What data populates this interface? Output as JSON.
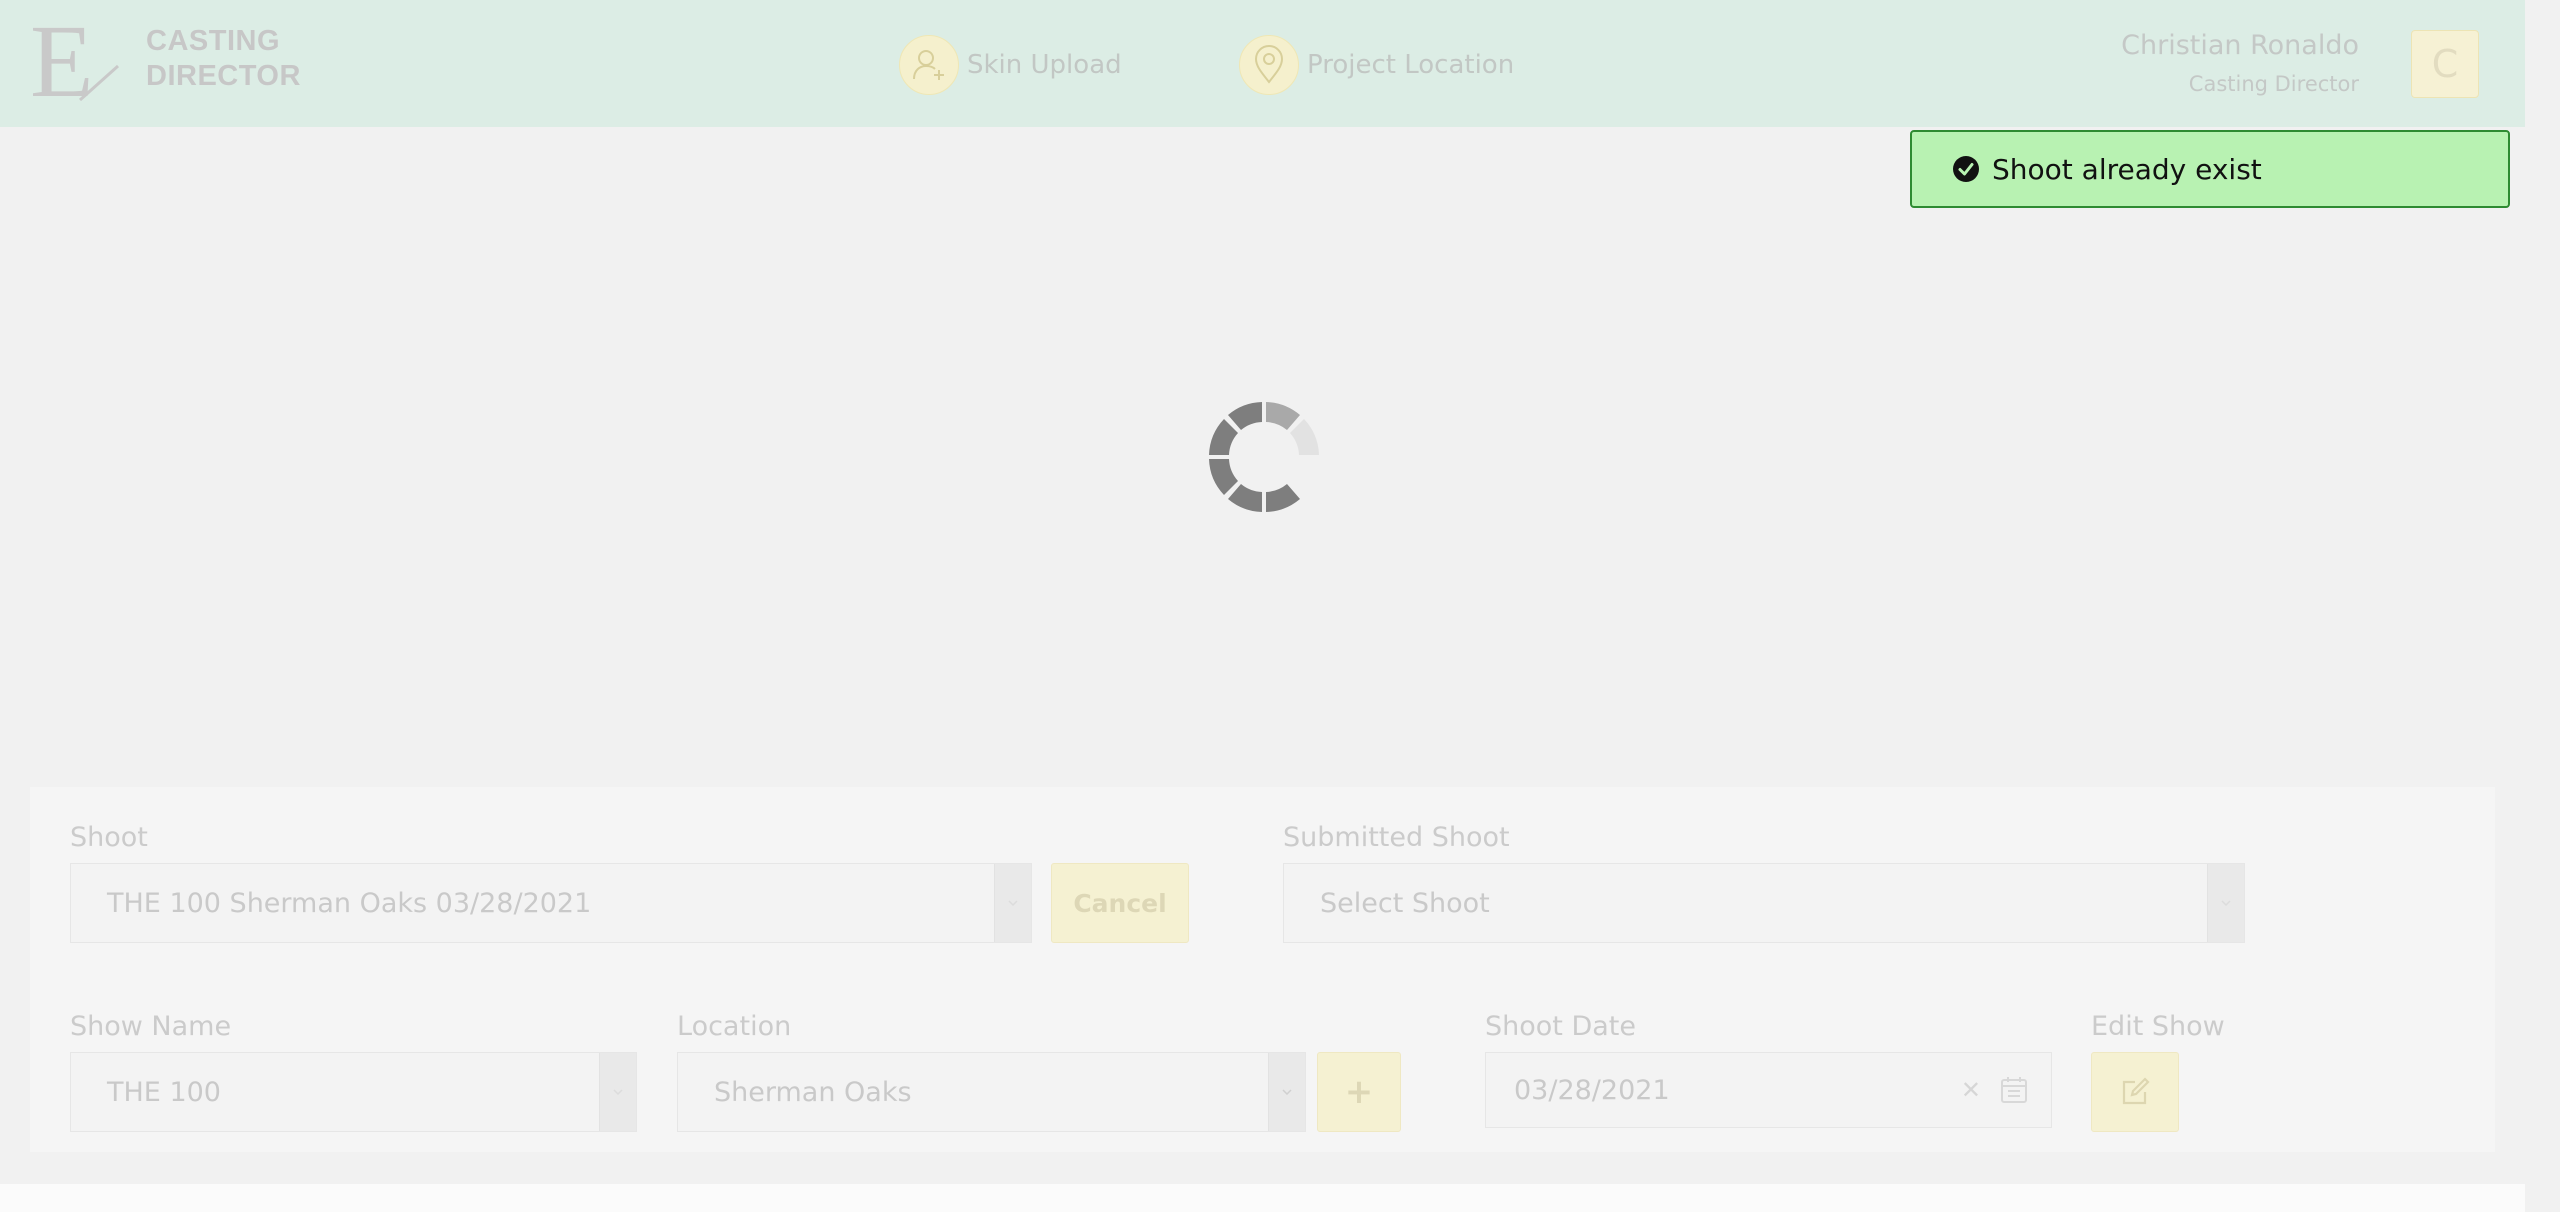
{
  "header": {
    "logo_lines": [
      "CASTING",
      "DIRECTOR"
    ],
    "nav": [
      {
        "label": "Skin Upload",
        "icon": "user-add-icon"
      },
      {
        "label": "Project Location",
        "icon": "map-pin-icon"
      }
    ],
    "user": {
      "name": "Christian Ronaldo",
      "role": "Casting Director",
      "initial": "C"
    }
  },
  "toast": {
    "message": "Shoot already exist",
    "icon": "check-circle-icon",
    "color": "#b8f2b2"
  },
  "form": {
    "shoot": {
      "label": "Shoot",
      "value": "THE 100 Sherman Oaks 03/28/2021",
      "cancel_label": "Cancel"
    },
    "submitted_shoot": {
      "label": "Submitted Shoot",
      "placeholder": "Select Shoot"
    },
    "show_name": {
      "label": "Show Name",
      "value": "THE 100"
    },
    "location": {
      "label": "Location",
      "value": "Sherman Oaks",
      "add_label": "+"
    },
    "shoot_date": {
      "label": "Shoot Date",
      "value": "03/28/2021"
    },
    "edit_show": {
      "label": "Edit Show",
      "icon": "edit-icon"
    }
  },
  "colors": {
    "header_bg": "#dcede5",
    "accent_yellow": "#f5f1d2",
    "toast_border": "#2e8b32"
  }
}
